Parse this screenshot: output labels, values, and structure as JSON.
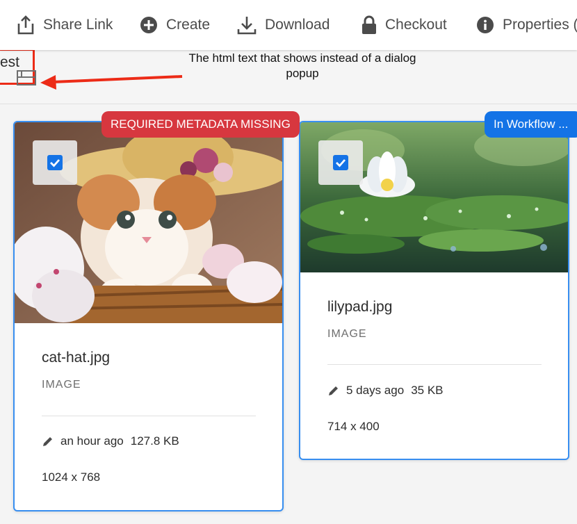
{
  "toolbar": {
    "items": [
      {
        "label": "Share Link",
        "icon": "share-icon"
      },
      {
        "label": "Create",
        "icon": "plus-circle-icon"
      },
      {
        "label": "Download",
        "icon": "download-icon"
      },
      {
        "label": "Checkout",
        "icon": "lock-icon"
      },
      {
        "label": "Properties (",
        "icon": "info-icon"
      }
    ]
  },
  "header": {
    "title_fragment": "est",
    "annotation": "The html text that shows instead of a dialog popup"
  },
  "cards": [
    {
      "filename": "cat-hat.jpg",
      "type": "IMAGE",
      "modified": "an hour ago",
      "size": "127.8 KB",
      "dimensions": "1024 x 768",
      "badge": "REQUIRED METADATA MISSING",
      "selected": true
    },
    {
      "filename": "lilypad.jpg",
      "type": "IMAGE",
      "modified": "5 days ago",
      "size": "35 KB",
      "dimensions": "714 x 400",
      "badge": "In Workflow ...",
      "selected": true
    }
  ],
  "colors": {
    "accent": "#1473e6",
    "card_border": "#378ef0",
    "badge_error": "#d7373f",
    "annotation_red": "#ec2b17"
  }
}
